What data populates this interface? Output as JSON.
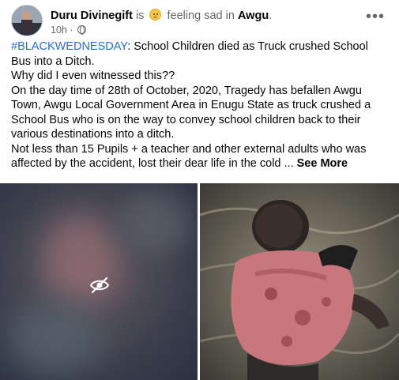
{
  "post": {
    "author": "Duru Divinegift",
    "is_text": " is ",
    "feeling_text": " feeling sad in ",
    "location": "Awgu",
    "location_suffix": ".",
    "time": "10h",
    "dot": "·",
    "more_icon": "ellipsis-icon",
    "hashtag": "#BLACKWEDNESDAY",
    "headline_rest": ": School Children died as Truck crushed School Bus into a Ditch.",
    "line2": "Why did I even witnessed this??",
    "para1": "On the day time of 28th of October, 2020, Tragedy has befallen Awgu Town, Awgu Local Government Area in Enugu State as truck crushed a School Bus who is on the way to convey school children back to their various destinations into a ditch.",
    "para2": "Not less than 15 Pupils + a teacher and other external adults who was affected by the accident, lost their dear life in the cold ... ",
    "see_more": "See More"
  },
  "media": {
    "left_icon": "eye-slash-icon",
    "colors": {
      "accent_link": "#216fdb",
      "muted": "#65676b"
    }
  }
}
